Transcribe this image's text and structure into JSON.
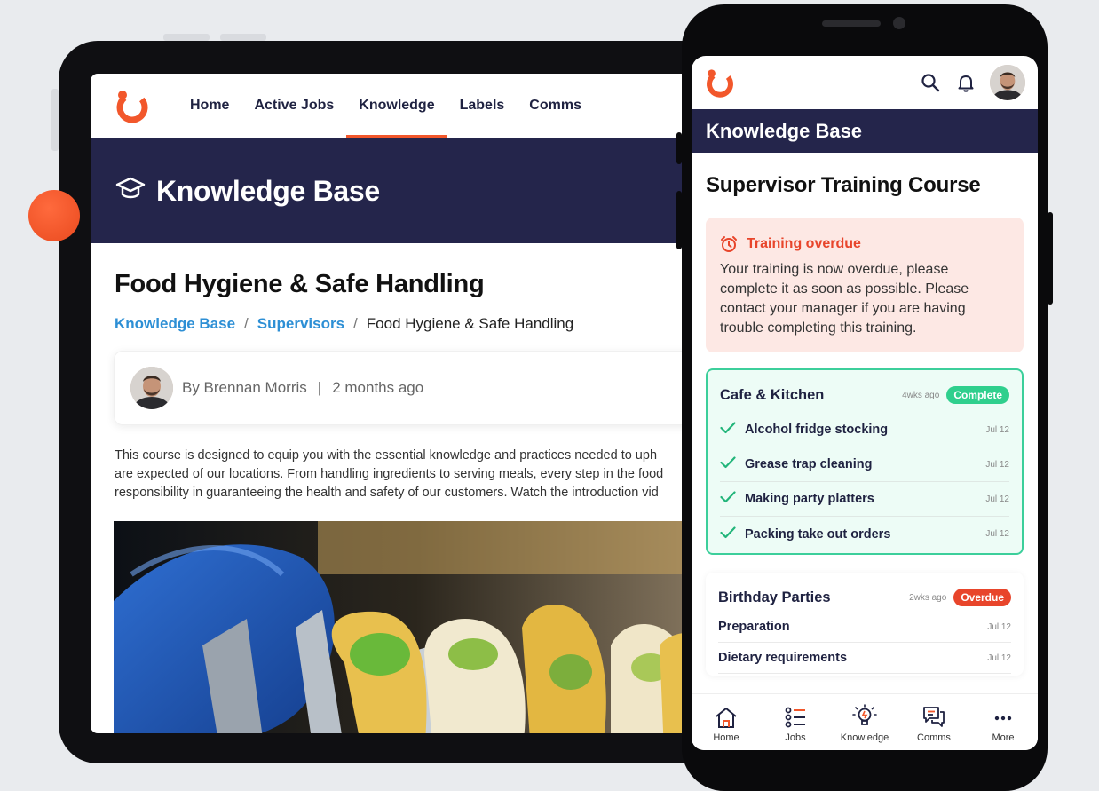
{
  "tablet": {
    "nav": {
      "items": [
        {
          "label": "Home"
        },
        {
          "label": "Active Jobs"
        },
        {
          "label": "Knowledge"
        },
        {
          "label": "Labels"
        },
        {
          "label": "Comms"
        }
      ],
      "active_index": 2
    },
    "hero_title": "Knowledge Base",
    "article": {
      "title": "Food Hygiene & Safe Handling",
      "breadcrumb": [
        "Knowledge Base",
        "Supervisors",
        "Food Hygiene & Safe Handling"
      ],
      "breadcrumb_separator": "/",
      "author": "By Brennan Morris",
      "author_separator": "|",
      "posted": "2 months ago",
      "description_lines": [
        "This course is designed to equip you with the essential knowledge and practices needed to uph",
        "are expected of our locations. From handling ingredients to serving meals, every step in the food",
        "responsibility in guaranteeing the health and safety of our customers. Watch the introduction vid"
      ]
    }
  },
  "phone": {
    "band_title": "Knowledge Base",
    "course_title": "Supervisor Training Course",
    "alert": {
      "title": "Training overdue",
      "text": "Your training is now overdue, please complete it as soon as possible. Please contact your manager if you are having trouble completing this training."
    },
    "sections": [
      {
        "title": "Cafe & Kitchen",
        "ago": "4wks ago",
        "status": "Complete",
        "items": [
          {
            "label": "Alcohol fridge stocking",
            "date": "Jul 12"
          },
          {
            "label": "Grease trap cleaning",
            "date": "Jul 12"
          },
          {
            "label": "Making party platters",
            "date": "Jul 12"
          },
          {
            "label": "Packing take out orders",
            "date": "Jul 12"
          }
        ]
      },
      {
        "title": "Birthday Parties",
        "ago": "2wks ago",
        "status": "Overdue",
        "items": [
          {
            "label": "Preparation",
            "date": "Jul 12"
          },
          {
            "label": "Dietary requirements",
            "date": "Jul 12"
          }
        ]
      }
    ],
    "tabbar": [
      {
        "label": "Home"
      },
      {
        "label": "Jobs"
      },
      {
        "label": "Knowledge"
      },
      {
        "label": "Comms"
      },
      {
        "label": "More"
      }
    ]
  },
  "colors": {
    "accent": "#f2572b",
    "navy": "#24254b",
    "link": "#2d8fd5",
    "success": "#2fcf8d",
    "danger": "#e8452b"
  }
}
